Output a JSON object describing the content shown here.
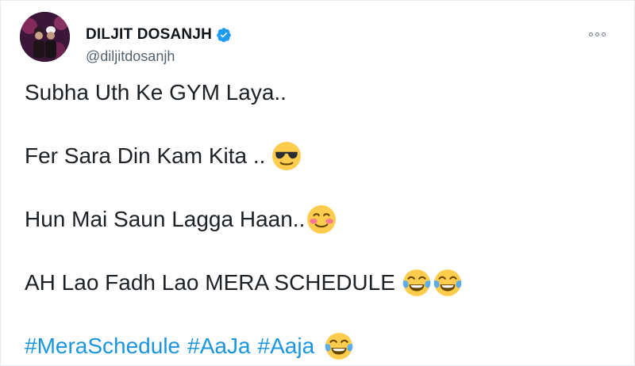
{
  "user": {
    "display_name": "DILJIT DOSANJH",
    "handle": "@diljitdosanjh",
    "verified_icon": "verified-badge-icon",
    "avatar": "profile-photo"
  },
  "more_icon": "more-options-icon",
  "tweet": {
    "line1": "Subha Uth Ke GYM Laya..",
    "line2": "Fer Sara Din Kam Kita ..",
    "line2_emoji": "sunglasses-face-emoji",
    "line3": "Hun Mai Saun Lagga Haan..",
    "line3_emoji": "smiling-blush-face-emoji",
    "line4": "AH Lao Fadh Lao MERA SCHEDULE",
    "line4_emoji": [
      "tears-of-joy-emoji",
      "tears-of-joy-emoji"
    ],
    "hashtags": [
      "#MeraSchedule",
      "#AaJa",
      "#Aaja"
    ],
    "line5_emoji": "tears-of-joy-emoji"
  },
  "colors": {
    "link": "#1b95e0",
    "verified": "#1d9bf0",
    "text": "#0f1419",
    "secondary": "#536471"
  }
}
